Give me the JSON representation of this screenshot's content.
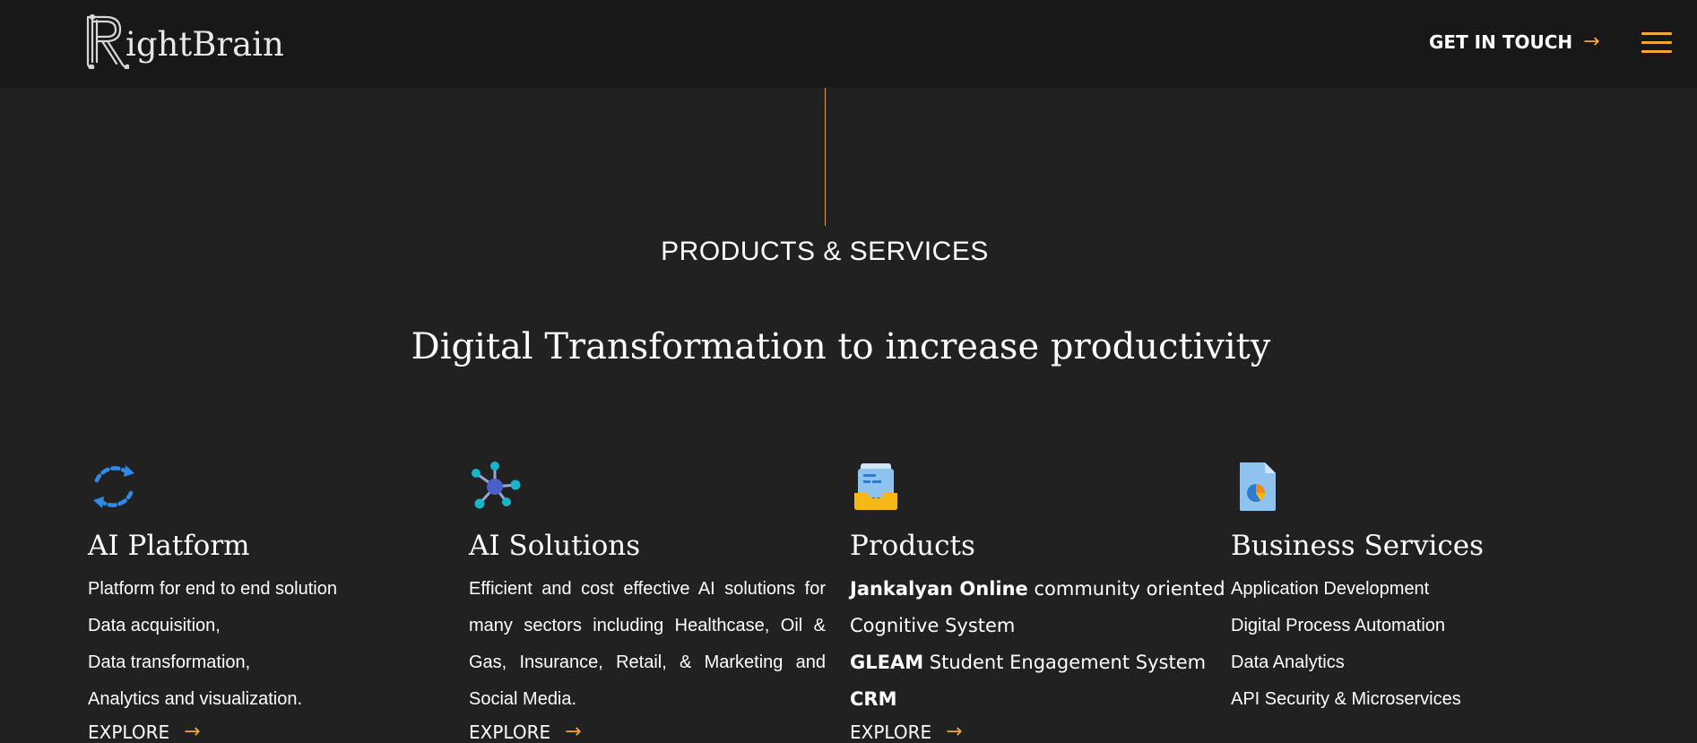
{
  "header": {
    "brand": "RightBrain",
    "brand_rest": "ightBrain",
    "contact_label": "GET IN TOUCH",
    "contact_arrow": "→",
    "menu_icon": "hamburger-icon",
    "accent_color": "#f0a63c"
  },
  "section": {
    "eyebrow": "PRODUCTS & SERVICES",
    "headline": "Digital Transformation to increase productivity"
  },
  "columns": [
    {
      "icon": "sync-icon",
      "title": "AI Platform",
      "lines": [
        "Platform for end to end solution",
        "Data acquisition,",
        "Data transformation,",
        "Analytics and visualization."
      ],
      "cta": "EXPLORE"
    },
    {
      "icon": "network-icon",
      "title": "AI Solutions",
      "paragraph": "Efficient and cost effective AI solutions for many sectors including Healthcase, Oil & Gas, Insurance, Retail, & Marketing and Social Media.",
      "cta": "EXPLORE"
    },
    {
      "icon": "inbox-icon",
      "title": "Products",
      "items": [
        {
          "bold": "Jankalyan Online",
          "rest": " community oriented"
        },
        {
          "bold": "",
          "rest": "Cognitive System"
        },
        {
          "bold": "GLEAM",
          "rest": " Student Engagement System"
        },
        {
          "bold": "CRM",
          "rest": ""
        }
      ],
      "cta": "EXPLORE"
    },
    {
      "icon": "report-icon",
      "title": "Business Services",
      "lines": [
        "Application Development",
        "Digital Process Automation",
        "Data Analytics",
        "API Security & Microservices"
      ]
    }
  ],
  "explore_arrow": "→"
}
